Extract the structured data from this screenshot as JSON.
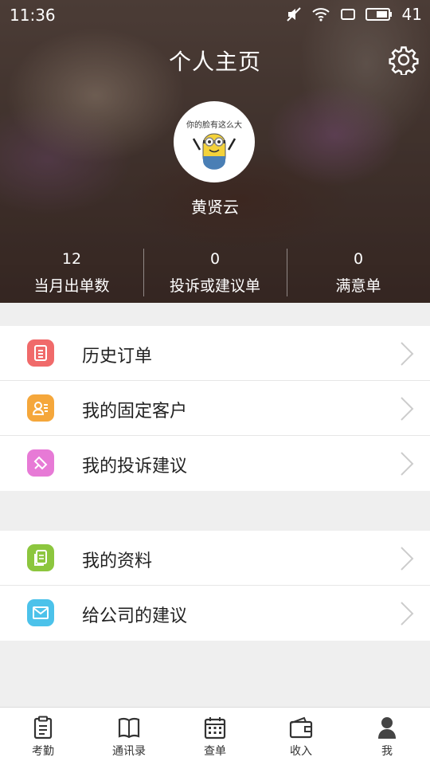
{
  "status_bar": {
    "time": "11:36",
    "battery": "41"
  },
  "header": {
    "title": "个人主页"
  },
  "profile": {
    "avatar_caption": "你的脸有这么大",
    "name": "黄贤云"
  },
  "stats": [
    {
      "value": "12",
      "label": "当月出单数"
    },
    {
      "value": "0",
      "label": "投诉或建议单"
    },
    {
      "value": "0",
      "label": "满意单"
    }
  ],
  "menu_group_1": [
    {
      "label": "历史订单",
      "icon": "order-history-icon",
      "color": "#f06a6a"
    },
    {
      "label": "我的固定客户",
      "icon": "fixed-customer-icon",
      "color": "#f5a73b"
    },
    {
      "label": "我的投诉建议",
      "icon": "complaint-icon",
      "color": "#e77ad6"
    }
  ],
  "menu_group_2": [
    {
      "label": "我的资料",
      "icon": "profile-info-icon",
      "color": "#8cc63e"
    },
    {
      "label": "给公司的建议",
      "icon": "mail-icon",
      "color": "#4cc2ea"
    }
  ],
  "tabbar": [
    {
      "label": "考勤",
      "icon": "clipboard-icon"
    },
    {
      "label": "通讯录",
      "icon": "book-icon"
    },
    {
      "label": "查单",
      "icon": "calendar-icon"
    },
    {
      "label": "收入",
      "icon": "wallet-icon"
    },
    {
      "label": "我",
      "icon": "person-icon"
    }
  ]
}
